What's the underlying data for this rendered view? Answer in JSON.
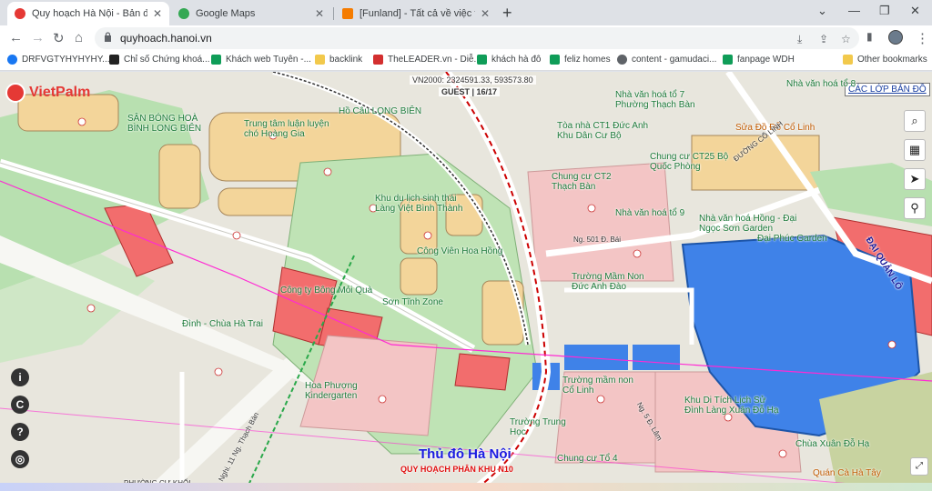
{
  "tabs": [
    {
      "title": "Quy hoạch Hà Nội - Bản đồ",
      "active": true
    },
    {
      "title": "Google Maps",
      "active": false
    },
    {
      "title": "[Funland] - Tất cả về việc thi công",
      "active": false
    }
  ],
  "address": {
    "url": "quyhoach.hanoi.vn"
  },
  "bookmarks": [
    {
      "label": "DRFVGTYHYHYHY..."
    },
    {
      "label": "Chỉ số Chứng khoá..."
    },
    {
      "label": "Khách web Tuyên -..."
    },
    {
      "label": "backlink"
    },
    {
      "label": "TheLEADER.vn - Diễ..."
    },
    {
      "label": "khách hà đô"
    },
    {
      "label": "feliz homes"
    },
    {
      "label": "content - gamudaci..."
    },
    {
      "label": "fanpage WDH"
    },
    {
      "label": "Other bookmarks"
    }
  ],
  "map": {
    "logo": "VietPalm",
    "coord_text": "VN2000: 2324591.33, 593573.80",
    "guest_text": "GUEST | 16/17",
    "layers_button": "CÁC LỚP BẢN ĐỒ",
    "capital_label": "Thủ đô Hà Nội",
    "zone_label": "QUY HOẠCH PHÂN KHU N10",
    "labels": {
      "l1": "SÂN BÓNG HOÀ BÌNH LONG BIÊN",
      "l2": "Trung tâm luận luyện chó Hoàng Gia",
      "l3": "Hồ Câu LONG BIÊN",
      "l4": "Khu du lịch sinh thái Làng Việt Bình Thành",
      "l5": "Công Viên Hoa Hồng",
      "l6": "Sơn Tĩnh Zone",
      "l7": "Công ty Bông Mỏi Quà",
      "l8": "Đình - Chùa Hà Trai",
      "l9": "Hoa Phượng Kindergarten",
      "l10": "Nhà văn hoá tổ 7 Phường Thạch Bàn",
      "l11": "Tòa nhà CT1 Đức Anh Khu Dân Cư Bộ",
      "l12": "Chung cư CT2 Thạch Bàn",
      "l13": "Chung cư CT25 Bộ Quốc Phòng",
      "l14": "Nhà văn hoá tổ 9",
      "l15": "Trường Mầm Non Đức Anh Đào",
      "l16": "Nhà văn hoá Hồng - Đại Ngọc Sơn Garden",
      "l17": "Đại Phúc Garden",
      "l18": "Khu Di Tích Lịch Sử Đình Làng Xuân Đỗ Hạ",
      "l19": "Chùa Xuân Đỗ Hạ",
      "l20": "Quán Cà Hà Tây",
      "l21": "Sửa Đồ Đỗ Cổ Linh",
      "l22": "Nhà văn hoá tổ 8",
      "l23": "Trường mầm non Cổ Linh",
      "l24": "ĐẠI QUẢN LÔ",
      "l25": "Chung cư Tổ 4",
      "l26": "Trường Trung Học"
    },
    "roads": {
      "r1": "ĐƯỜNG CỔ LINH",
      "r2": "Nghi. 11 Ng. Thạch Bàn",
      "r3": "Ng. 501 Đ. Bái",
      "r4": "Ng. 5 Đ. Lâm",
      "r5": "PHƯỜNG CỰ KHỐI"
    }
  },
  "colors": {
    "red_zone": "#f26d6d",
    "yellow_zone": "#f3d59a",
    "green_zone": "#b8e0b0",
    "water": "#3f82e8",
    "pink_zone": "#f3c5c5"
  }
}
